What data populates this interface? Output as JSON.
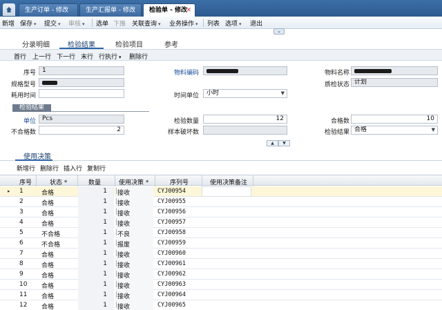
{
  "window_tabs": [
    {
      "label": "生产订单 - 修改",
      "active": false
    },
    {
      "label": "生产汇报单 - 修改",
      "active": false
    },
    {
      "label": "检验单 - 修改",
      "active": true
    }
  ],
  "menu": {
    "new": "新增",
    "save": "保存",
    "submit": "提交",
    "audit": "审核",
    "select": "选单",
    "push": "下推",
    "related": "关联查询",
    "business": "业务操作",
    "list": "列表",
    "options": "选项",
    "exit": "退出"
  },
  "form_tabs": [
    "分录明细",
    "检验结果",
    "检验项目",
    "参考"
  ],
  "sub_toolbar": {
    "first": "首行",
    "prev": "上一行",
    "next": "下一行",
    "last": "末行",
    "row_exec": "行执行",
    "delete_row": "删除行"
  },
  "fields": {
    "seq_label": "序号",
    "seq_value": "1",
    "material_code_label": "物料编码",
    "material_name_label": "物料名称",
    "spec_label": "规格型号",
    "quality_status_label": "质检状态",
    "quality_status_value": "计划",
    "time_used_label": "耗用时间",
    "time_unit_label": "时间单位",
    "time_unit_value": "小时"
  },
  "result_section": {
    "title": "检验结果",
    "unit_label": "单位",
    "unit_value": "Pcs",
    "inspect_qty_label": "检验数量",
    "inspect_qty_value": "12",
    "qualified_label": "合格数",
    "qualified_value": "10",
    "unqualified_label": "不合格数",
    "unqualified_value": "2",
    "sample_damage_label": "样本破坏数",
    "result_label": "检验结果",
    "result_value": "合格"
  },
  "detail_tab": "使用决策",
  "grid_toolbar": {
    "add_row": "新增行",
    "delete_row": "删除行",
    "insert_row": "插入行",
    "copy_row": "复制行"
  },
  "grid": {
    "headers": [
      "序号",
      "状态 *",
      "数量",
      "使用决策 *",
      "序列号",
      "使用决策备注"
    ],
    "rows": [
      {
        "seq": "1",
        "status": "合格",
        "qty": "1",
        "decision": "接收",
        "serial": "CYJ00954"
      },
      {
        "seq": "2",
        "status": "合格",
        "qty": "1",
        "decision": "接收",
        "serial": "CYJ00955"
      },
      {
        "seq": "3",
        "status": "合格",
        "qty": "1",
        "decision": "接收",
        "serial": "CYJ00956"
      },
      {
        "seq": "4",
        "status": "合格",
        "qty": "1",
        "decision": "接收",
        "serial": "CYJ00957"
      },
      {
        "seq": "5",
        "status": "不合格",
        "qty": "1",
        "decision": "不良",
        "serial": "CYJ00958"
      },
      {
        "seq": "6",
        "status": "不合格",
        "qty": "1",
        "decision": "报废",
        "serial": "CYJ00959"
      },
      {
        "seq": "7",
        "status": "合格",
        "qty": "1",
        "decision": "接收",
        "serial": "CYJ00960"
      },
      {
        "seq": "8",
        "status": "合格",
        "qty": "1",
        "decision": "接收",
        "serial": "CYJ00961"
      },
      {
        "seq": "9",
        "status": "合格",
        "qty": "1",
        "decision": "接收",
        "serial": "CYJ00962"
      },
      {
        "seq": "10",
        "status": "合格",
        "qty": "1",
        "decision": "接收",
        "serial": "CYJ00963"
      },
      {
        "seq": "11",
        "status": "合格",
        "qty": "1",
        "decision": "接收",
        "serial": "CYJ00964"
      },
      {
        "seq": "12",
        "status": "合格",
        "qty": "1",
        "decision": "接收",
        "serial": "CYJ00965"
      }
    ]
  }
}
